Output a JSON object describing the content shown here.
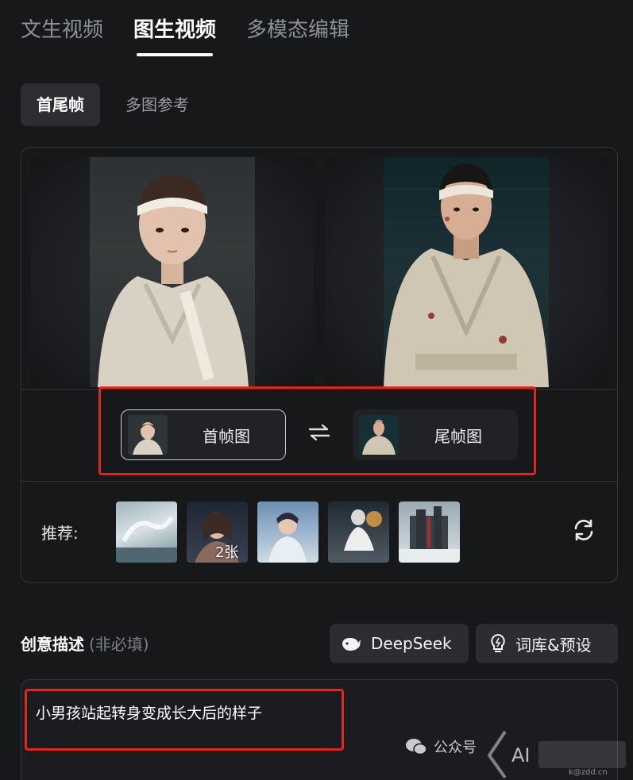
{
  "tabs": [
    {
      "label": "文生视频",
      "active": false
    },
    {
      "label": "图生视频",
      "active": true
    },
    {
      "label": "多模态编辑",
      "active": false
    }
  ],
  "subtabs": [
    {
      "label": "首尾帧",
      "active": true
    },
    {
      "label": "多图参考",
      "active": false
    }
  ],
  "frames": {
    "first_label": "首帧图",
    "last_label": "尾帧图",
    "swap_icon": "swap-arrows-icon"
  },
  "recommend": {
    "label": "推荐:",
    "count_badge": "2张",
    "items": [
      "white-dragon-scene",
      "girl-in-snow",
      "boy-with-dragon",
      "warrior-fight",
      "red-castle"
    ]
  },
  "description": {
    "title": "创意描述",
    "optional": "(非必填)",
    "deepseek_label": "DeepSeek",
    "library_label": "词库&预设",
    "prompt_value": "小男孩站起转身变成长大后的样子"
  },
  "watermark": {
    "text": "公众号",
    "logo_text": "AI",
    "brand_text": "k@zdd.cn"
  },
  "colors": {
    "background": "#17181a",
    "highlight": "#e0261d",
    "panel_border": "#34363a"
  }
}
